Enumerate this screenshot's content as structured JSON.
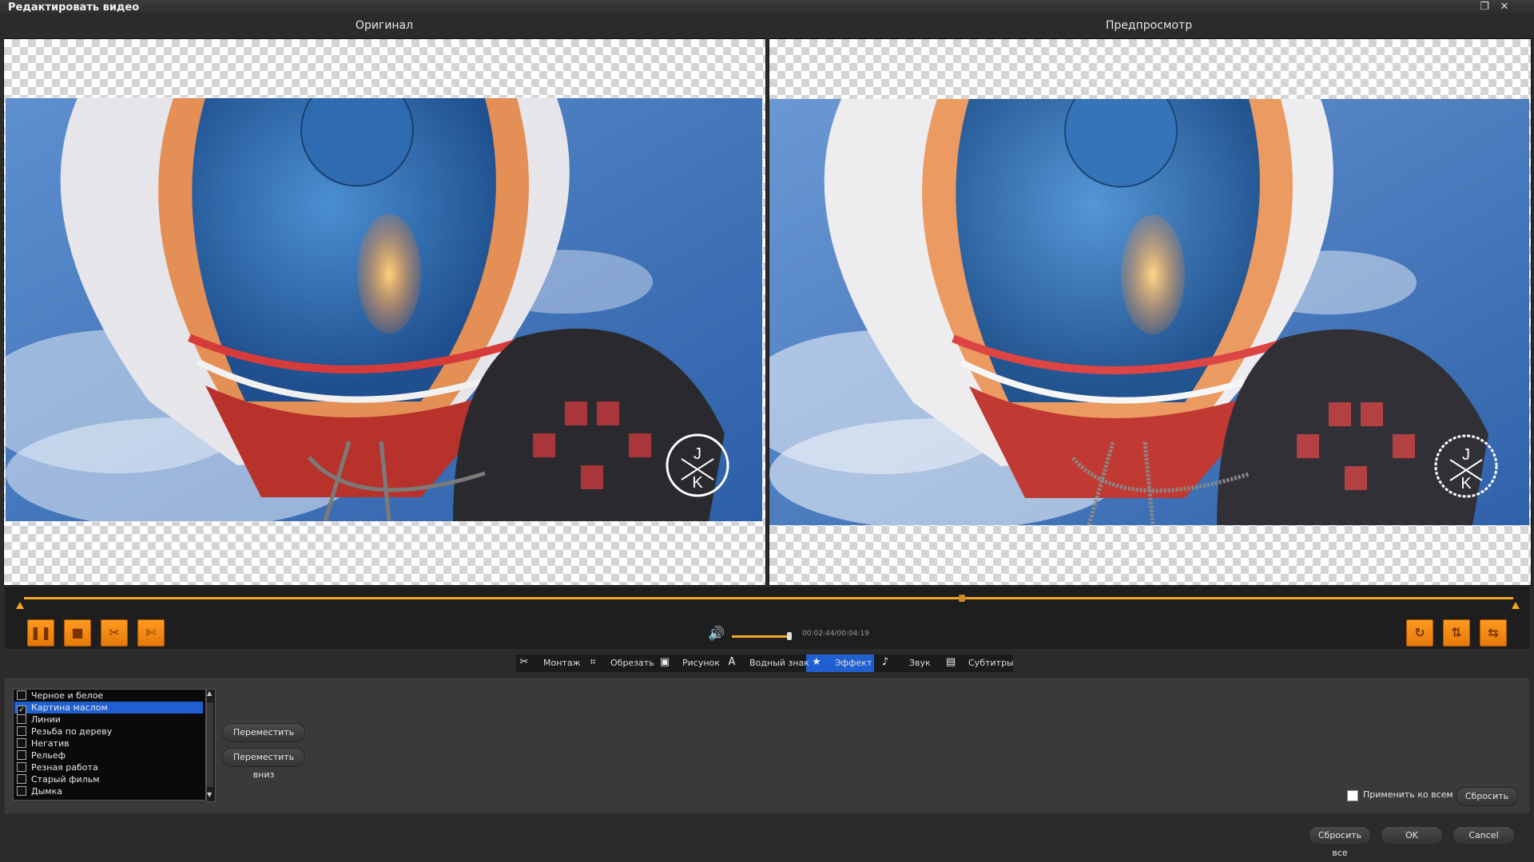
{
  "window": {
    "title": "Редактировать видео",
    "restore_icon": "restore-icon",
    "close_glyph": "✕"
  },
  "panes": {
    "original_label": "Оригинал",
    "preview_label": "Предпросмотр"
  },
  "watermark": {
    "top_letter": "J",
    "bottom_letter": "K"
  },
  "playback": {
    "time": "00:02:44/00:04:19",
    "progress": 0.63,
    "volume": 0.82,
    "buttons": [
      "pause-icon",
      "stop-icon",
      "cut-icon",
      "split-icon"
    ],
    "right_buttons": [
      "rotate-icon",
      "flip-vertical-icon",
      "flip-horizontal-icon"
    ]
  },
  "tabs": [
    {
      "label": "Монтаж",
      "icon": "scissors-icon"
    },
    {
      "label": "Обрезать",
      "icon": "crop-icon"
    },
    {
      "label": "Рисунок",
      "icon": "image-icon"
    },
    {
      "label": "Водный знак",
      "icon": "watermark-icon"
    },
    {
      "label": "Эффект",
      "icon": "star-icon",
      "active": true
    },
    {
      "label": "Звук",
      "icon": "music-note-icon"
    },
    {
      "label": "Субтитры",
      "icon": "subtitles-icon"
    }
  ],
  "effects": {
    "items": [
      {
        "label": "Черное и белое",
        "checked": false
      },
      {
        "label": "Картина маслом",
        "checked": true,
        "selected": true
      },
      {
        "label": "Линии",
        "checked": false
      },
      {
        "label": "Резьба по дереву",
        "checked": false
      },
      {
        "label": "Негатив",
        "checked": false
      },
      {
        "label": "Рельеф",
        "checked": false
      },
      {
        "label": "Резная работа",
        "checked": false
      },
      {
        "label": "Старый фильм",
        "checked": false
      },
      {
        "label": "Дымка",
        "checked": false
      }
    ],
    "move_up": "Переместить вверх",
    "move_down": "Переместить вниз",
    "apply_all": "Применить ко всем",
    "reset": "Сбросить"
  },
  "footer": {
    "reset_all": "Сбросить все",
    "ok": "OK",
    "cancel": "Cancel"
  },
  "colors": {
    "accent": "#f5a623",
    "selection": "#1f5fd0",
    "sky": "#3f74b8"
  }
}
